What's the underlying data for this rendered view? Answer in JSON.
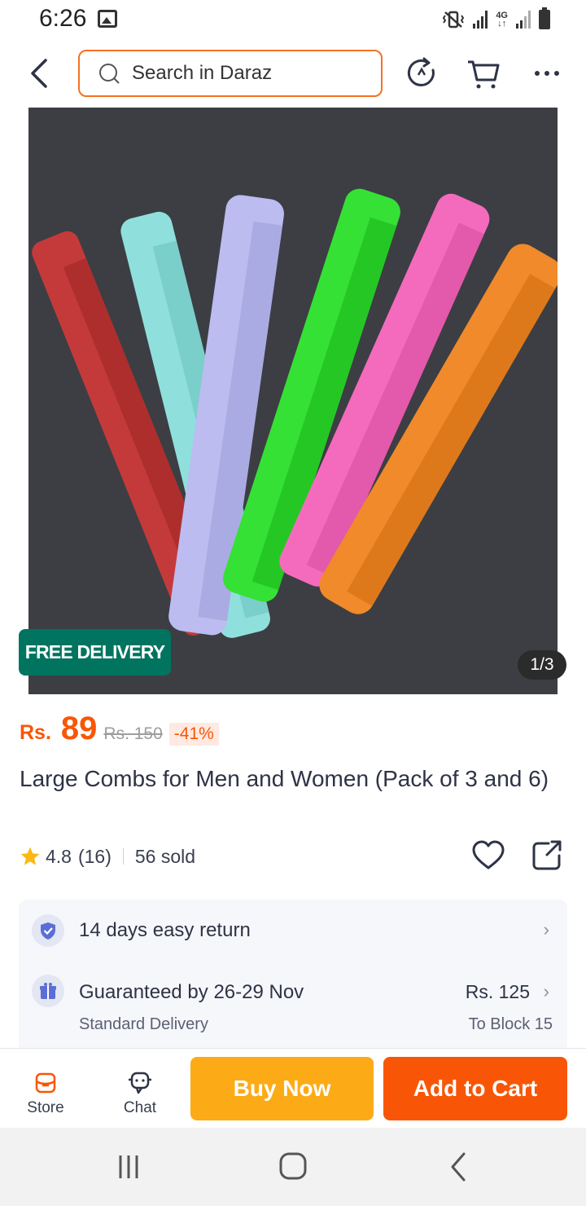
{
  "status_bar": {
    "time": "6:26",
    "network": "4G"
  },
  "header": {
    "search_placeholder": "Search in Daraz"
  },
  "gallery": {
    "badge": "FREE DELIVERY",
    "counter": "1/3"
  },
  "product": {
    "currency": "Rs.",
    "price": "89",
    "original_price": "Rs. 150",
    "discount": "-41%",
    "title": "Large Combs for Men and Women (Pack of 3 and 6)",
    "rating": "4.8",
    "rating_count": "(16)",
    "sold": "56 sold"
  },
  "services": {
    "return_label": "14 days easy return",
    "delivery_label": "Guaranteed by 26-29 Nov",
    "delivery_type": "Standard Delivery",
    "delivery_fee": "Rs. 125",
    "delivery_location": "To Block 15"
  },
  "actions": {
    "store_label": "Store",
    "chat_label": "Chat",
    "buy_now_label": "Buy Now",
    "add_to_cart_label": "Add to Cart"
  },
  "colors": {
    "brand_orange": "#f85606",
    "buy_now_yellow": "#fcab17",
    "free_delivery_green": "#00745f"
  },
  "icons": [
    "back-icon",
    "search-icon",
    "refresh-icon",
    "cart-icon",
    "more-icon",
    "star-icon",
    "heart-icon",
    "share-icon",
    "shield-check-icon",
    "gift-icon",
    "store-icon",
    "chat-icon"
  ]
}
